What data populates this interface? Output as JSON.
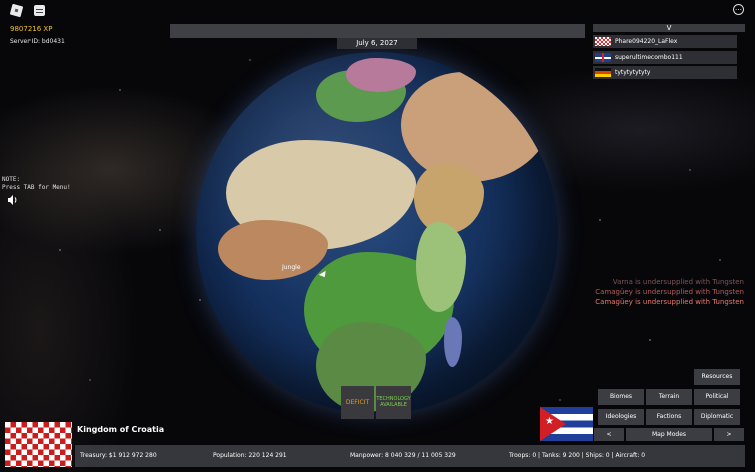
{
  "hud": {
    "xp": "9807216 XP",
    "server_id": "Server ID: bd0431",
    "note_line1": "NOTE:",
    "note_line2": "Press TAB for Menu!"
  },
  "top": {
    "date": "July 6, 2027"
  },
  "players": {
    "collapse_label": "V",
    "list": [
      {
        "name": "Phare094220_LaFlex"
      },
      {
        "name": "superultimecombo111"
      },
      {
        "name": "tytytytytyty"
      }
    ]
  },
  "notifications": [
    {
      "text": "Varna is undersupplied with Tungsten",
      "color": "#7a5555"
    },
    {
      "text": "Camagüey is undersupplied with Tungsten",
      "color": "#b35c5c"
    },
    {
      "text": "Camagüey is undersupplied with Tungsten",
      "color": "#e8796a"
    }
  ],
  "map": {
    "hover_label": "Jungle"
  },
  "alerts": {
    "deficit": "DEFICIT",
    "tech_line1": "TECHNOLOGY",
    "tech_line2": "AVAILABLE"
  },
  "panel": {
    "resources": "Resources",
    "biomes": "Biomes",
    "terrain": "Terrain",
    "political": "Political",
    "ideologies": "Ideologies",
    "factions": "Factions",
    "diplomatic": "Diplomatic",
    "prev": "<",
    "map_modes": "Map Modes",
    "next": ">"
  },
  "country": {
    "name": "Kingdom of Croatia"
  },
  "stats": {
    "treasury": "Treasury:   $1 912 972 280",
    "population": "Population: 220 124 291",
    "manpower": "Manpower:   8 040 329  /  11 005 329",
    "military": "Troops: 0  |  Tanks: 9 200  |  Ships: 0  |  Aircraft: 0"
  }
}
